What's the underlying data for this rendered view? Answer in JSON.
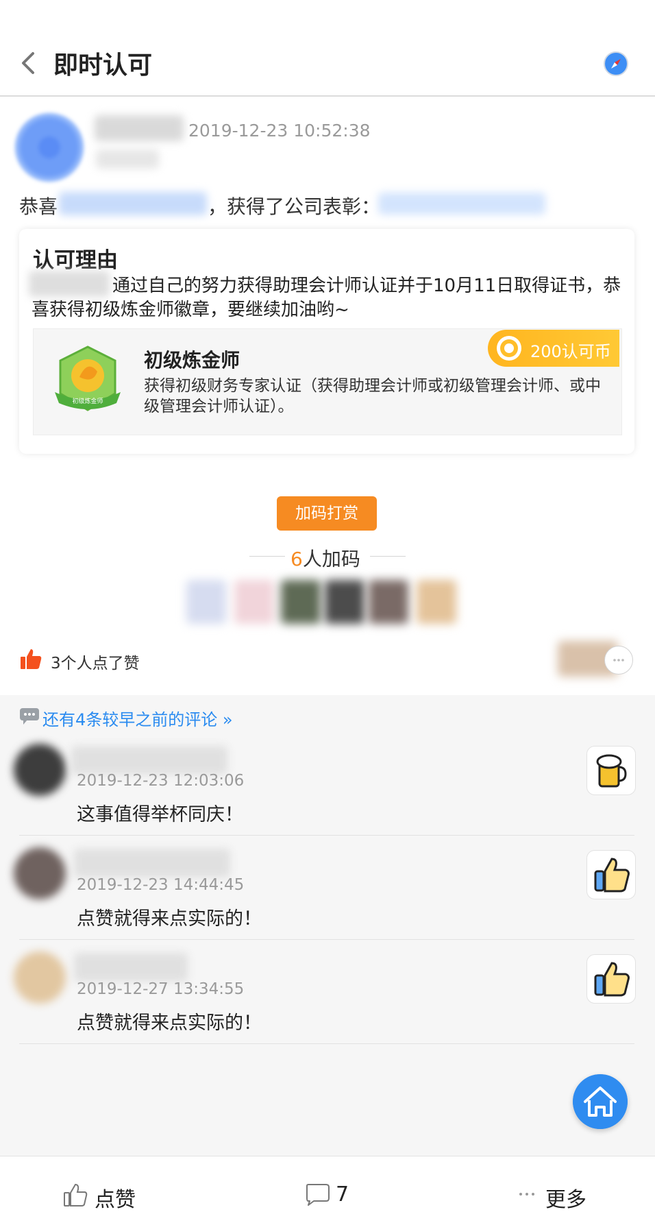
{
  "header": {
    "title": "即时认可"
  },
  "post": {
    "time": "2019-12-23 10:52:38",
    "congrats_prefix": "恭喜",
    "congrats_suffix": "，获得了公司表彰："
  },
  "reason": {
    "title": "认可理由",
    "text": "通过自己的努力获得助理会计师认证并于10月11日取得证书，恭喜获得初级炼金师徽章，要继续加油哟~",
    "badge_label": "初级炼金师",
    "badge_name": "初级炼金师",
    "badge_desc": "获得初级财务专家认证（获得助理会计师或初级管理会计师、或中级管理会计师认证）。",
    "coin_text": "200认可币"
  },
  "reward": {
    "button_label": "加码打赏",
    "count": "6",
    "count_suffix": "人加码"
  },
  "likes": {
    "text": "3个人点了赞"
  },
  "comments": {
    "more_link": "还有4条较早之前的评论 »",
    "items": [
      {
        "time": "2019-12-23 12:03:06",
        "text": "这事值得举杯同庆！",
        "sticker": "beer-icon"
      },
      {
        "time": "2019-12-23 14:44:45",
        "text": "点赞就得来点实际的！",
        "sticker": "thumbs-up-icon"
      },
      {
        "time": "2019-12-27 13:34:55",
        "text": "点赞就得来点实际的！",
        "sticker": "thumbs-up-icon"
      }
    ]
  },
  "bottom_bar": {
    "like_label": "点赞",
    "comment_count": "7",
    "more_label": "更多"
  },
  "colors": {
    "accent_blue": "#2a8bf0",
    "reward_orange": "#f68b22",
    "coin_yellow": "#ffbe2a",
    "like_red": "#f4511e"
  }
}
